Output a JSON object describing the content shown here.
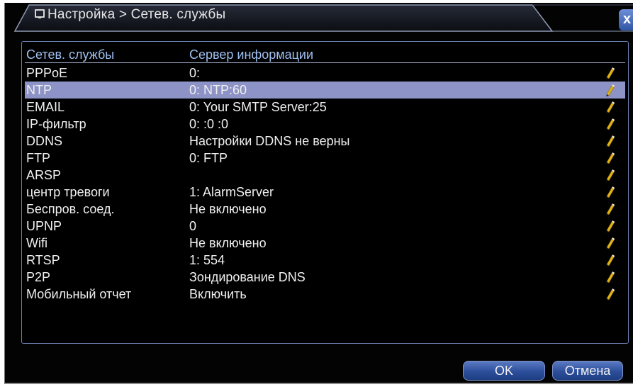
{
  "window": {
    "title": "Настройка > Сетев. службы",
    "close_label": "x"
  },
  "table": {
    "headers": [
      "Сетев. службы",
      "Сервер информации"
    ],
    "selected_index": 1,
    "rows": [
      {
        "service": "PPPoE",
        "info": "0:"
      },
      {
        "service": "NTP",
        "info": "0: NTP:60"
      },
      {
        "service": "EMAIL",
        "info": "0: Your SMTP Server:25"
      },
      {
        "service": "IP-фильтр",
        "info": "0: :0 :0"
      },
      {
        "service": "DDNS",
        "info": "Настройки DDNS не верны"
      },
      {
        "service": "FTP",
        "info": "0: FTP"
      },
      {
        "service": "ARSP",
        "info": ""
      },
      {
        "service": "центр тревоги",
        "info": "1: AlarmServer"
      },
      {
        "service": "Беспров. соед.",
        "info": "Не включено"
      },
      {
        "service": "UPNP",
        "info": "0"
      },
      {
        "service": "Wifi",
        "info": "Не включено"
      },
      {
        "service": "RTSP",
        "info": "1: 554"
      },
      {
        "service": "P2P",
        "info": "Зондирование DNS"
      },
      {
        "service": "Мобильный отчет",
        "info": "Включить"
      }
    ],
    "edit_icon": "pencil-icon"
  },
  "buttons": {
    "ok_label": "OK",
    "cancel_label": "Отмена"
  },
  "colors": {
    "background": "#030303",
    "selected_row": "#8d93c6",
    "header_text": "#9fc0f0",
    "button": "#2d4f9b"
  }
}
